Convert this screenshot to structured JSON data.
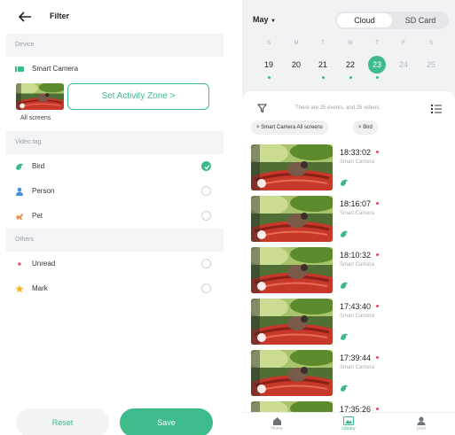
{
  "filter": {
    "title": "Filter",
    "sections": {
      "device": "Device",
      "video_tag": "Video tag",
      "others": "Others"
    },
    "device_name": "Smart Camera",
    "activity_zone_button": "Set Activity Zone >",
    "all_screens": "All screens",
    "tags": [
      {
        "label": "Bird",
        "checked": true,
        "icon": "bird-icon"
      },
      {
        "label": "Person",
        "checked": false,
        "icon": "person-icon"
      },
      {
        "label": "Pet",
        "checked": false,
        "icon": "pet-icon"
      }
    ],
    "others": [
      {
        "label": "Unread",
        "checked": false,
        "icon": "unread-dot-icon"
      },
      {
        "label": "Mark",
        "checked": false,
        "icon": "star-icon"
      }
    ],
    "reset_label": "Reset",
    "save_label": "Save"
  },
  "library": {
    "month": "May",
    "storage_tabs": {
      "cloud": "Cloud",
      "sd": "SD Card"
    },
    "weekdays": [
      "S",
      "M",
      "T",
      "W",
      "T",
      "F",
      "S"
    ],
    "dates": [
      "19",
      "20",
      "21",
      "22",
      "23",
      "24",
      "25"
    ],
    "selected_date": "23",
    "summary": "There are 25 events, and 25 videos.",
    "chips": [
      "Smart Camera All screens",
      "Bird"
    ],
    "events": [
      {
        "time": "18:33:02",
        "source": "Smart Camera"
      },
      {
        "time": "18:16:07",
        "source": "Smart Camera"
      },
      {
        "time": "18:10:32",
        "source": "Smart Camera"
      },
      {
        "time": "17:43:40",
        "source": "Smart Camera"
      },
      {
        "time": "17:39:44",
        "source": "Smart Camera"
      },
      {
        "time": "17:35:26",
        "source": ""
      }
    ],
    "bottom_nav": [
      "Home",
      "Library",
      "User"
    ]
  },
  "colors": {
    "accent": "#3dbb8a",
    "unread": "#e8475b",
    "bird_feeder": "#d9412c"
  }
}
